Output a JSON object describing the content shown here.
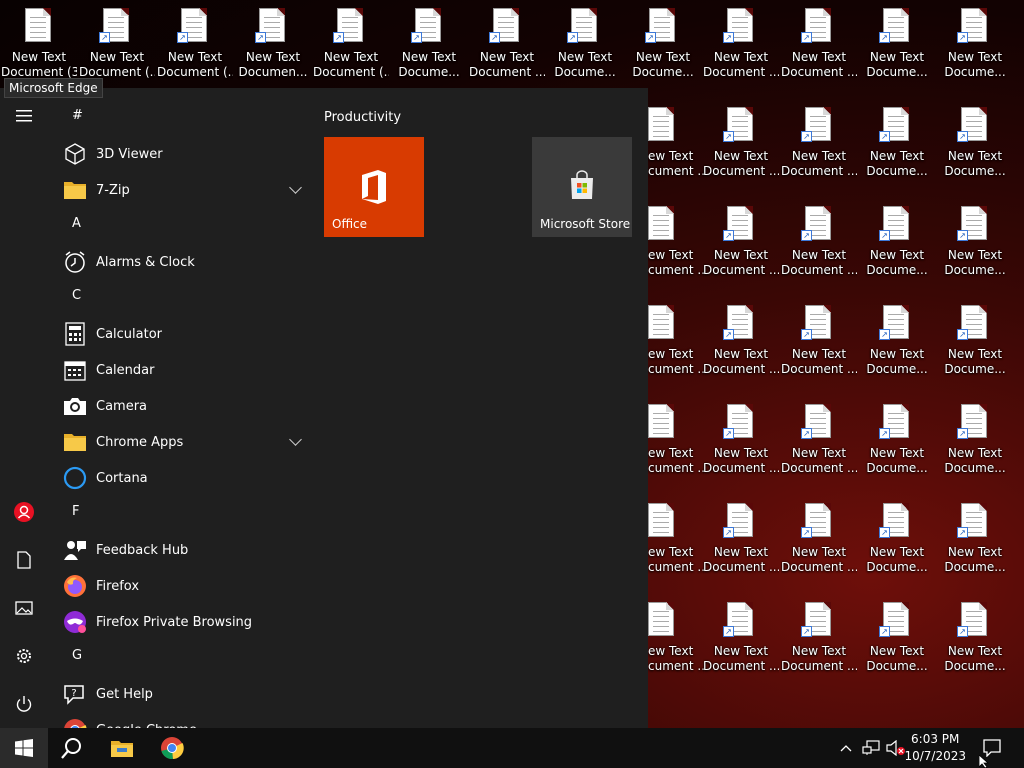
{
  "desktop": {
    "icons": [
      {
        "label": "New Text Document (3)",
        "shortcut": false
      },
      {
        "label": "New Text Document (...",
        "shortcut": true
      },
      {
        "label": "New Text Document (...",
        "shortcut": true
      },
      {
        "label": "New Text Documen...",
        "shortcut": true
      },
      {
        "label": "New Text Document (...",
        "shortcut": true
      },
      {
        "label": "New Text Docume...",
        "shortcut": true
      },
      {
        "label": "New Text Document ...",
        "shortcut": true
      },
      {
        "label": "New Text Docume...",
        "shortcut": true
      },
      {
        "label": "New Text Docume...",
        "shortcut": true
      },
      {
        "label": "New Text Document ...",
        "shortcut": true
      },
      {
        "label": "New Text Document ...",
        "shortcut": true
      },
      {
        "label": "New Text Docume...",
        "shortcut": true
      },
      {
        "label": "New Text Docume...",
        "shortcut": true
      }
    ],
    "right_columns": [
      {
        "label": "New Text Document ..."
      },
      {
        "label": "New Text Document ..."
      },
      {
        "label": "New Text Docume..."
      },
      {
        "label": "New Text Docume..."
      }
    ],
    "partial_label": "ew Text\ncument ..."
  },
  "tooltip": "Microsoft Edge",
  "start_menu": {
    "apps": [
      {
        "type": "header",
        "text": "#"
      },
      {
        "type": "app",
        "name": "3D Viewer",
        "icon": "3d-viewer-icon"
      },
      {
        "type": "app",
        "name": "7-Zip",
        "icon": "folder-icon",
        "expandable": true
      },
      {
        "type": "header",
        "text": "A"
      },
      {
        "type": "app",
        "name": "Alarms & Clock",
        "icon": "alarm-clock-icon"
      },
      {
        "type": "header",
        "text": "C"
      },
      {
        "type": "app",
        "name": "Calculator",
        "icon": "calculator-icon"
      },
      {
        "type": "app",
        "name": "Calendar",
        "icon": "calendar-icon"
      },
      {
        "type": "app",
        "name": "Camera",
        "icon": "camera-icon"
      },
      {
        "type": "app",
        "name": "Chrome Apps",
        "icon": "folder-icon",
        "expandable": true
      },
      {
        "type": "app",
        "name": "Cortana",
        "icon": "cortana-icon"
      },
      {
        "type": "header",
        "text": "F"
      },
      {
        "type": "app",
        "name": "Feedback Hub",
        "icon": "feedback-hub-icon"
      },
      {
        "type": "app",
        "name": "Firefox",
        "icon": "firefox-icon"
      },
      {
        "type": "app",
        "name": "Firefox Private Browsing",
        "icon": "firefox-private-icon"
      },
      {
        "type": "header",
        "text": "G"
      },
      {
        "type": "app",
        "name": "Get Help",
        "icon": "get-help-icon"
      },
      {
        "type": "app",
        "name": "Google Chrome",
        "icon": "chrome-icon"
      }
    ],
    "group_title": "Productivity",
    "tiles": [
      {
        "label": "Office",
        "color": "#d83b01"
      },
      {
        "label": "Microsoft Store",
        "color": "#3a3a3a"
      }
    ]
  },
  "taskbar": {
    "time": "6:03 PM",
    "date": "10/7/2023"
  }
}
